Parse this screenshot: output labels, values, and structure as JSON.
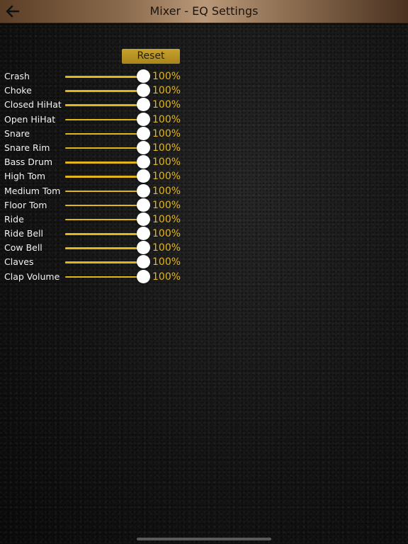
{
  "header": {
    "title": "Mixer - EQ Settings",
    "back_icon": "arrow-left-icon"
  },
  "reset_label": "Reset",
  "colors": {
    "accent": "#e2b51c",
    "thumb": "#ffffff",
    "header_bronze": "#b89878"
  },
  "mixer": {
    "rows": [
      {
        "label": "Crash",
        "value": "100%",
        "level": 1.0
      },
      {
        "label": "Choke",
        "value": "100%",
        "level": 1.0
      },
      {
        "label": "Closed HiHat",
        "value": "100%",
        "level": 1.0
      },
      {
        "label": "Open HiHat",
        "value": "100%",
        "level": 1.0
      },
      {
        "label": "Snare",
        "value": "100%",
        "level": 1.0
      },
      {
        "label": "Snare Rim",
        "value": "100%",
        "level": 1.0
      },
      {
        "label": "Bass Drum",
        "value": "100%",
        "level": 1.0
      },
      {
        "label": "High Tom",
        "value": "100%",
        "level": 1.0
      },
      {
        "label": "Medium Tom",
        "value": "100%",
        "level": 1.0
      },
      {
        "label": "Floor Tom",
        "value": "100%",
        "level": 1.0
      },
      {
        "label": "Ride",
        "value": "100%",
        "level": 1.0
      },
      {
        "label": "Ride Bell",
        "value": "100%",
        "level": 1.0
      },
      {
        "label": "Cow Bell",
        "value": "100%",
        "level": 1.0
      },
      {
        "label": "Claves",
        "value": "100%",
        "level": 1.0
      },
      {
        "label": "Clap Volume",
        "value": "100%",
        "level": 1.0
      }
    ]
  }
}
